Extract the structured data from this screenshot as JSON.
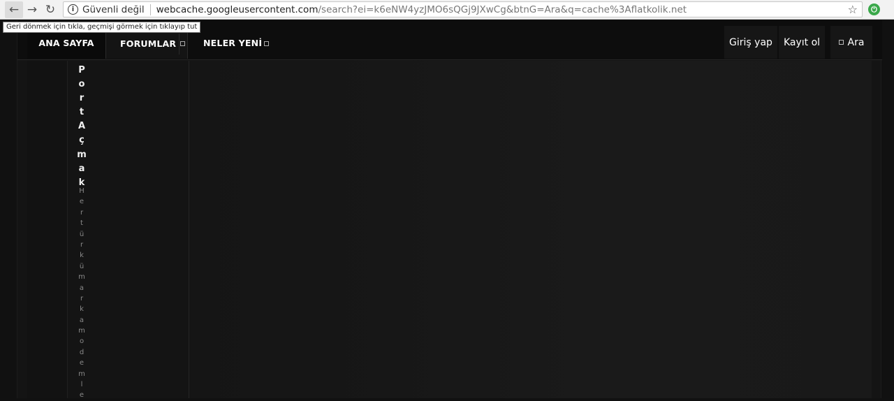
{
  "browser": {
    "security_label": "Güvenli değil",
    "url_host": "webcache.googleusercontent.com",
    "url_rest": "/search?ei=k6eNW4yzJMO6sQGj9JXwCg&btnG=Ara&q=cache%3Aflatkolik.net",
    "back_tooltip": "Geri dönmek için tıkla, geçmişi görmek için tıklayıp tut",
    "icons": [
      "back-arrow-icon",
      "forward-arrow-icon",
      "reload-icon",
      "info-icon",
      "star-icon",
      "extension-icon"
    ]
  },
  "nav": {
    "home": "ANA SAYFA",
    "forums": "FORUMLAR",
    "whats_new": "NELER YENİ",
    "login": "Giriş yap",
    "register": "Kayıt ol",
    "search": "Ara"
  },
  "sidebar": {
    "title_chars": [
      "P",
      "o",
      "r",
      "t",
      "A",
      "ç",
      "m",
      "a",
      "k"
    ],
    "desc_chars": [
      "H",
      "e",
      "r",
      "t",
      "ü",
      "r",
      "k",
      "ü",
      "m",
      "a",
      "r",
      "k",
      "a",
      "m",
      "o",
      "d",
      "e",
      "m",
      "l",
      "e"
    ]
  },
  "colors": {
    "background": "#111111",
    "nav_bg": "#0d0d0d",
    "text": "#ffffff",
    "muted_text": "#8a8a8a",
    "extension_green": "#3aa84a"
  }
}
